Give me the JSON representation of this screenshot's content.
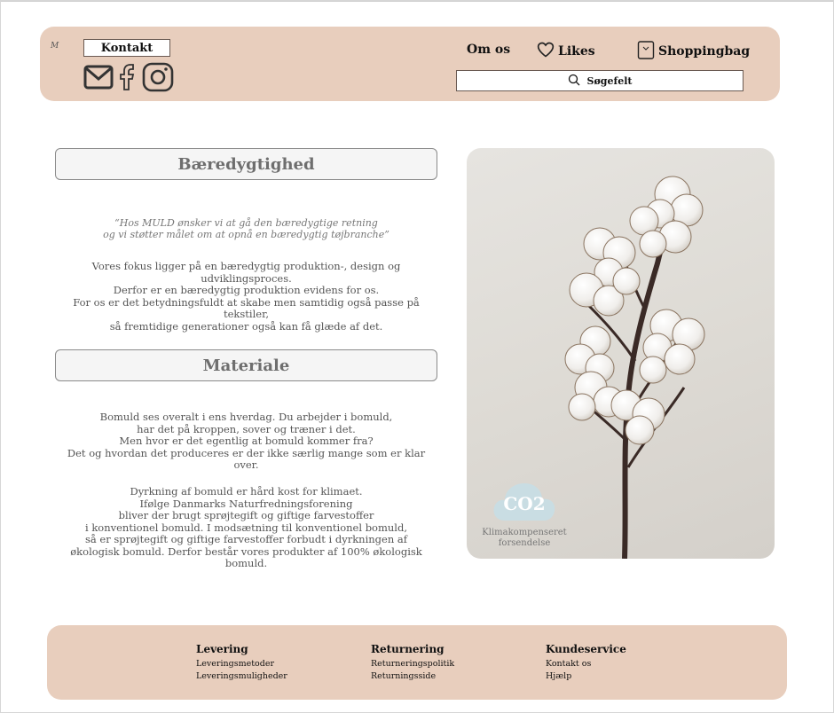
{
  "header": {
    "logo_text": "M",
    "contact_label": "Kontakt",
    "social_icons": [
      "mail-icon",
      "facebook-icon",
      "instagram-icon"
    ],
    "nav": {
      "about_label": "Om os",
      "likes_label": "Likes",
      "bag_label": "Shoppingbag"
    },
    "search_label": "Søgefelt"
  },
  "sustainability": {
    "title": "Bæredygtighed",
    "quote_line1": "“Hos MULD ønsker vi at gå den bæredygtige retning",
    "quote_line2": "og vi støtter målet om at opnå en bæredygtig tøjbranche”",
    "body": [
      "Vores fokus ligger på en bæredygtig produktion-, design og udviklingsproces.",
      "Derfor er en bæredygtig produktion evidens for os.",
      "For os er det betydningsfuldt at skabe men samtidig også passe på tekstiler,",
      "så fremtidige generationer også kan få glæde af det."
    ]
  },
  "material": {
    "title": "Materiale",
    "para1": [
      "Bomuld ses overalt i ens hverdag. Du arbejder i bomuld,",
      "har det på kroppen, sover og træner i det.",
      "Men hvor er det egentlig at bomuld kommer fra?",
      "Det og hvordan det produceres er der ikke særlig mange som er klar over."
    ],
    "para2": [
      "Dyrkning af bomuld er hård kost for klimaet.",
      "Ifølge Danmarks Naturfredningsforening",
      "bliver der brugt sprøjtegift og giftige farvestoffer",
      "i konventionel bomuld. I modsætning til konventionel bomuld,",
      "så er sprøjtegift og giftige farvestoffer forbudt i dyrkningen af",
      "økologisk bomuld. Derfor består vores produkter af 100% økologisk bomuld."
    ]
  },
  "co2_badge": {
    "text": "CO2",
    "label_line1": "Klimakompenseret",
    "label_line2": "forsendelse",
    "color": "#c9dde3"
  },
  "footer": {
    "columns": [
      {
        "title": "Levering",
        "links": [
          "Leveringsmetoder",
          "Leveringsmuligheder"
        ]
      },
      {
        "title": "Returnering",
        "links": [
          "Returneringspolitik",
          "Returningsside"
        ]
      },
      {
        "title": "Kundeservice",
        "links": [
          "Kontakt os",
          "Hjælp"
        ]
      }
    ]
  },
  "colors": {
    "header_bg": "#e8cebd",
    "footer_bg": "#e8cebd",
    "section_box_bg": "#f5f5f5"
  }
}
